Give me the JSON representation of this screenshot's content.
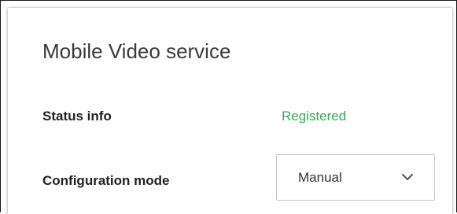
{
  "panel": {
    "title": "Mobile Video service"
  },
  "status": {
    "label": "Status info",
    "value": "Registered",
    "value_color": "#3aa856"
  },
  "configuration": {
    "label": "Configuration mode",
    "selected": "Manual",
    "icon": "chevron-down-icon"
  }
}
